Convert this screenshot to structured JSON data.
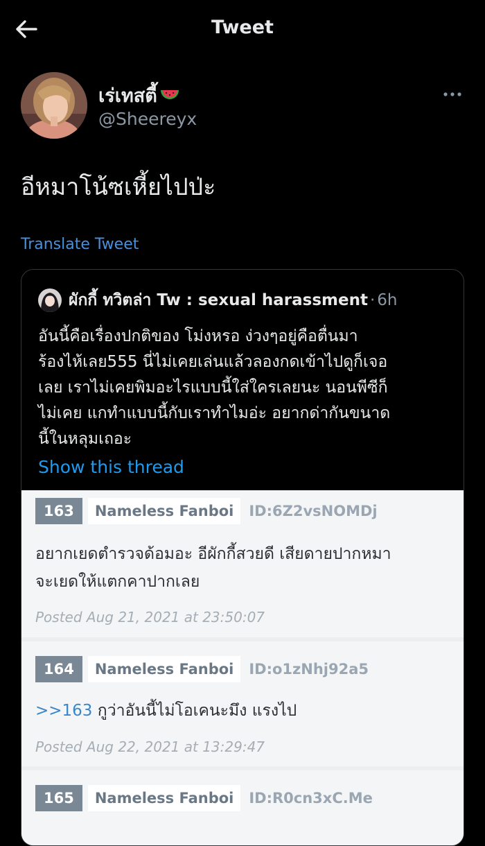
{
  "header": {
    "title": "Tweet"
  },
  "tweet": {
    "author_name": "เร่เทสตี้",
    "author_emoji": "watermelon-icon",
    "author_handle": "@Sheereyx",
    "text": "อีหมาโน้ซเหี้ยไปป่ะ",
    "translate_label": "Translate Tweet"
  },
  "quote": {
    "author_name": "ผักกี้ ทวิตล่า Tw : sexual harassment",
    "separator": "·",
    "time": "6h",
    "lines": [
      "อันนี้คือเรื่องปกติของ โม่งหรอ ง่วงๆอยู่คือตื่นมา",
      "ร้องไห้เลย555 นี่ไม่เคยเล่นแล้วลองกดเข้าไปดูก็เจอ",
      "เลย เราไม่เคยพิมอะไรแบบนี้ใส่ใครเลยนะ นอนพีซีก็",
      "ไม่เคย แกทำแบบนี้กับเราทำไมอ่ะ อยากด่ากันขนาด",
      "นี้ในหลุมเถอะ"
    ],
    "show_thread_label": "Show this thread"
  },
  "forum_posts": [
    {
      "number": "163",
      "name": "Nameless Fanboi",
      "id": "ID:6Z2vsNOMDj",
      "ref": "",
      "lines": [
        "อยากเยดตำรวจด้อมอะ อีผักกี้สวยดี เสียดายปากหมา",
        "จะเยดให้แตกคาปากเลย"
      ],
      "date": "Posted Aug 21, 2021 at 23:50:07"
    },
    {
      "number": "164",
      "name": "Nameless Fanboi",
      "id": "ID:o1zNhj92a5",
      "ref": ">>163",
      "lines": [
        " กูว่าอันนี้ไม่โอเคนะมึง แรงไป"
      ],
      "date": "Posted Aug 22, 2021 at 13:29:47"
    },
    {
      "number": "165",
      "name": "Nameless Fanboi",
      "id": "ID:R0cn3xC.Me",
      "ref": "",
      "lines": [],
      "date": ""
    }
  ],
  "colors": {
    "background": "#000000",
    "text_primary": "#e7e9ea",
    "text_secondary": "#8b98a5",
    "link": "#1d9bf0",
    "forum_bg": "#f4f5f6",
    "post_number_bg": "#7a8794"
  }
}
